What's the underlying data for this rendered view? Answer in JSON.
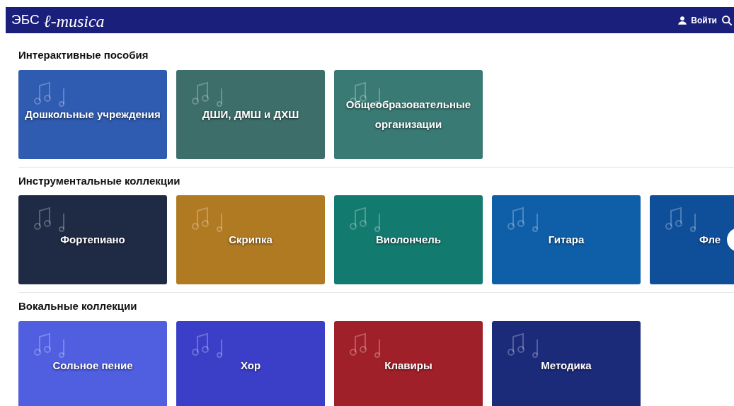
{
  "header": {
    "logo_prefix": "ЭБС",
    "logo_name": "ℓ-musica",
    "login": "Войти"
  },
  "sections": [
    {
      "title": "Интерактивные пособия",
      "cards": [
        {
          "label": "Дошкольные учреждения",
          "color": "#2f5bb0"
        },
        {
          "label": "ДШИ, ДМШ и ДХШ",
          "color": "#3d6e6a"
        },
        {
          "label": "Общеобразовательные организации",
          "color": "#3a7a74"
        }
      ]
    },
    {
      "title": "Инструментальные коллекции",
      "scroll_button": true,
      "cards": [
        {
          "label": "Фортепиано",
          "color": "#1f2a44"
        },
        {
          "label": "Скрипка",
          "color": "#b07a22"
        },
        {
          "label": "Виолончель",
          "color": "#137a70"
        },
        {
          "label": "Гитара",
          "color": "#0f5fa8"
        },
        {
          "label": "Фле",
          "color": "#0f4f9a"
        }
      ]
    },
    {
      "title": "Вокальные коллекции",
      "cards": [
        {
          "label": "Сольное пение",
          "color": "#4f5fe0"
        },
        {
          "label": "Хор",
          "color": "#3b3fc8"
        },
        {
          "label": "Клавиры",
          "color": "#a0202a"
        },
        {
          "label": "Методика",
          "color": "#1c2a7a"
        }
      ]
    }
  ]
}
